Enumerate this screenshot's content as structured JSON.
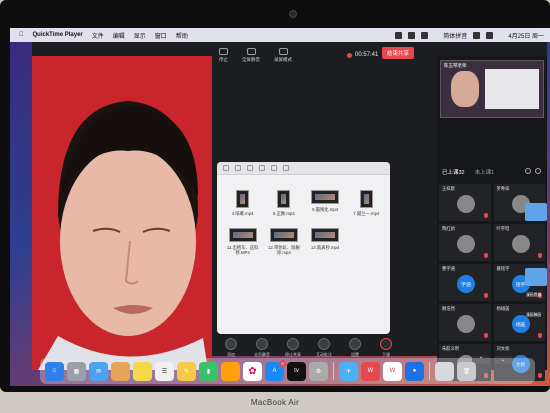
{
  "menubar": {
    "apple_icon": "apple-icon",
    "app_name": "QuickTime Player",
    "menus": [
      "文件",
      "编辑",
      "显示",
      "窗口",
      "帮助"
    ],
    "right": {
      "input_method": "简体拼音",
      "clock": "4月25日 周一"
    }
  },
  "zoom_toolbar": {
    "buttons": [
      "停止",
      "全屏静音",
      "录屏模式"
    ],
    "timer": "00:57:41",
    "end_share": "结束共享"
  },
  "file_window": {
    "files": [
      {
        "name": "4.咳嗽.mp4"
      },
      {
        "name": "6.正数.mp4"
      },
      {
        "name": "8.脑残化.mp4"
      },
      {
        "name": "7.疑兰一.mp4"
      },
      {
        "name": "11.出租车、这科修.MP4"
      },
      {
        "name": "12.带你玩、除删除.mp4"
      },
      {
        "name": "13.就表秒.mp4"
      }
    ]
  },
  "bottom_toolbar": {
    "items": [
      {
        "label": "添加",
        "icon": "add-icon"
      },
      {
        "label": "全员静音",
        "icon": "mute-all-icon"
      },
      {
        "label": "停止共享",
        "icon": "stop-share-icon"
      },
      {
        "label": "互动批注",
        "icon": "annotate-icon"
      },
      {
        "label": "设置",
        "icon": "settings-icon"
      },
      {
        "label": "下课",
        "icon": "end-class-icon"
      }
    ]
  },
  "right_panel": {
    "preview_name": "陈玉琴老师",
    "tabs": {
      "joined": "已上课32",
      "not_joined": "未上课1"
    },
    "participants": [
      {
        "name": "王梓默",
        "avatar": ""
      },
      {
        "name": "罗青梓",
        "avatar": ""
      },
      {
        "name": "陶红娇",
        "avatar": ""
      },
      {
        "name": "叶宇晗",
        "avatar": ""
      },
      {
        "name": "曹宇涵",
        "avatar": "宇涵"
      },
      {
        "name": "葛铭宇",
        "avatar": "铭宇"
      },
      {
        "name": "顾浩然",
        "avatar": ""
      },
      {
        "name": "杨翊菡",
        "avatar": "翊菡"
      },
      {
        "name": "朱航义昕",
        "avatar": ""
      },
      {
        "name": "刘文栎",
        "avatar": "文栎"
      }
    ]
  },
  "desktop": {
    "labels": [
      "漫画提纲",
      "漫画稿画"
    ]
  },
  "dock": {
    "badge_count": "9"
  },
  "laptop": {
    "model": "MacBook Air"
  }
}
